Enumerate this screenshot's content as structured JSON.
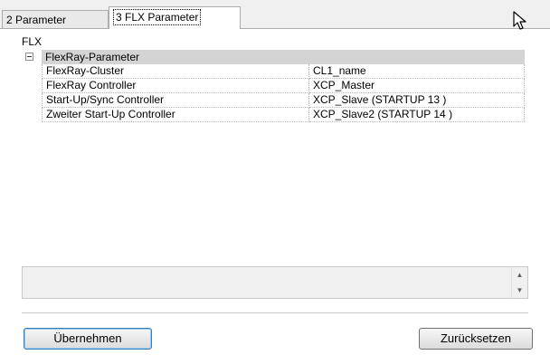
{
  "tabs": [
    {
      "label": "2 Parameter",
      "active": false
    },
    {
      "label": "3 FLX Parameter",
      "active": true
    }
  ],
  "group": {
    "label": "FLX"
  },
  "grid": {
    "category": "FlexRay-Parameter",
    "rows": [
      {
        "name": "FlexRay-Cluster",
        "value": "CL1_name"
      },
      {
        "name": "FlexRay Controller",
        "value": "XCP_Master"
      },
      {
        "name": "Start-Up/Sync Controller",
        "value": "XCP_Slave (STARTUP 13 )"
      },
      {
        "name": "Zweiter Start-Up Controller",
        "value": "XCP_Slave2 (STARTUP 14 )"
      }
    ]
  },
  "buttons": {
    "apply": "Übernehmen",
    "reset": "Zurücksetzen"
  },
  "icons": {
    "collapse": "collapse-icon",
    "cursor": "mouse-pointer-icon",
    "scroll_up": "scroll-up-icon",
    "scroll_down": "scroll-down-icon"
  }
}
